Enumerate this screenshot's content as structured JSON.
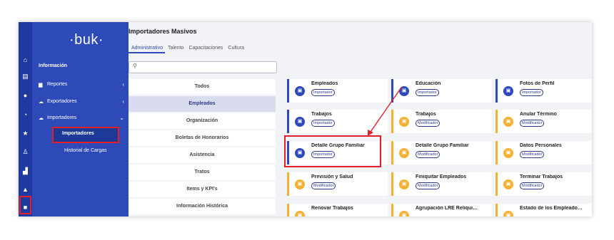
{
  "logo": "·buk·",
  "rail_icons": [
    "home-icon",
    "document-icon",
    "coin-icon",
    "clock-icon",
    "star-icon",
    "person-add-icon",
    "org-chart-icon",
    "graduation-icon",
    "folder-icon"
  ],
  "sidebar": {
    "section": "Información",
    "items": [
      {
        "label": "Reportes",
        "icon": "bar-chart-icon"
      },
      {
        "label": "Exportadores",
        "icon": "cloud-upload-icon"
      },
      {
        "label": "Importadores",
        "icon": "cloud-upload-icon"
      }
    ],
    "active_sub": "Importadores",
    "sub2": "Historial de Cargas"
  },
  "main": {
    "title": "Importadores Masivos",
    "tabs": [
      "Administrativo",
      "Talento",
      "Capacitaciones",
      "Cultura"
    ],
    "categories": [
      "Todos",
      "Empleados",
      "Organización",
      "Boletas de Honorarios",
      "Asistencia",
      "Tratos",
      "Items y KPI's",
      "Información Histórica"
    ],
    "active_category": "Empleados",
    "cards": [
      {
        "name": "Empleados",
        "badge": "Importador",
        "kind": "imp"
      },
      {
        "name": "Educación",
        "badge": "Importador",
        "kind": "imp"
      },
      {
        "name": "Fotos de Perfil",
        "badge": "Importador",
        "kind": "imp"
      },
      {
        "name": "Trabajos",
        "badge": "Importador",
        "kind": "imp"
      },
      {
        "name": "Trabajos",
        "badge": "Modificador",
        "kind": "mod"
      },
      {
        "name": "Anular Término",
        "badge": "Modificador",
        "kind": "mod"
      },
      {
        "name": "Detalle Grupo Familiar",
        "badge": "Importador",
        "kind": "imp"
      },
      {
        "name": "Detalle Grupo Familiar",
        "badge": "Modificador",
        "kind": "mod"
      },
      {
        "name": "Datos Personales",
        "badge": "Modificador",
        "kind": "mod"
      },
      {
        "name": "Previsión y Salud",
        "badge": "Modificador",
        "kind": "mod"
      },
      {
        "name": "Finiquitar Empleados",
        "badge": "Modificador",
        "kind": "mod"
      },
      {
        "name": "Terminar Trabajos",
        "badge": "Modificador",
        "kind": "mod"
      },
      {
        "name": "Renovar Trabajos",
        "badge": "",
        "kind": "mod"
      },
      {
        "name": "Agrupación LRE Reliqui…",
        "badge": "",
        "kind": "mod"
      },
      {
        "name": "Estado de los Empleado…",
        "badge": "",
        "kind": "mod"
      }
    ]
  },
  "colors": {
    "primary": "#2d4ab8",
    "rail": "#1f3a9e",
    "modifier": "#f4b133",
    "highlight": "#e3202a"
  }
}
